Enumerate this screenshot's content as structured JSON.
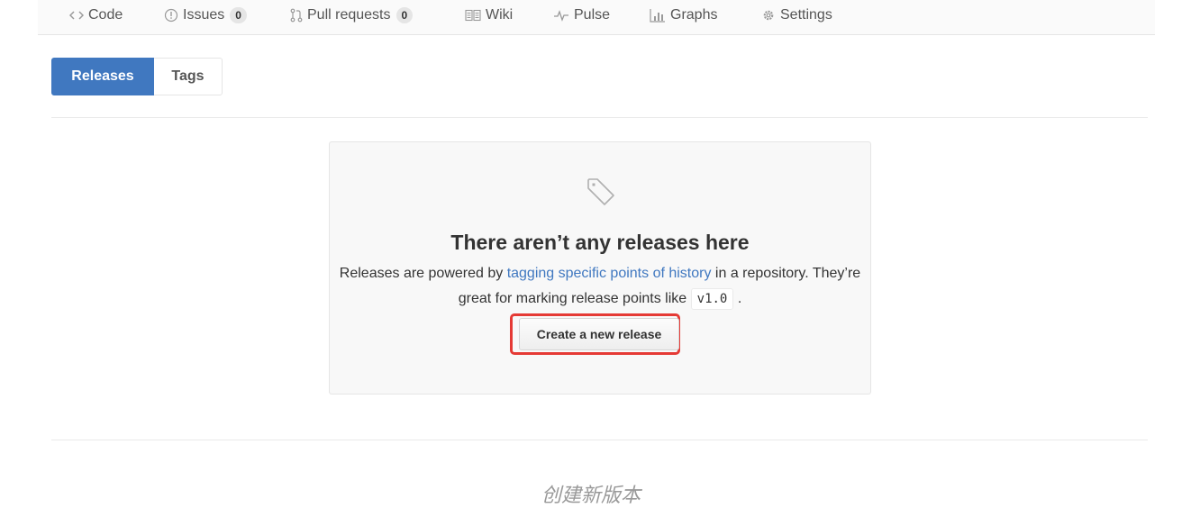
{
  "repo_nav": {
    "code": {
      "label": "Code",
      "icon": "code-icon"
    },
    "issues": {
      "label": "Issues",
      "count": "0",
      "icon": "issue-opened-icon"
    },
    "pull_requests": {
      "label": "Pull requests",
      "count": "0",
      "icon": "git-pull-request-icon"
    },
    "wiki": {
      "label": "Wiki",
      "icon": "book-icon"
    },
    "pulse": {
      "label": "Pulse",
      "icon": "pulse-icon"
    },
    "graphs": {
      "label": "Graphs",
      "icon": "graph-icon"
    },
    "settings": {
      "label": "Settings",
      "icon": "gear-icon"
    }
  },
  "subnav": {
    "releases": "Releases",
    "tags": "Tags"
  },
  "blankslate": {
    "icon": "tag-icon",
    "title": "There aren’t any releases here",
    "text_before_link": "Releases are powered by ",
    "link_text": "tagging specific points of history",
    "text_after_link": " in a repository. They’re great for marking release points like ",
    "code_example": "v1.0",
    "text_end": ".",
    "button_label": "Create a new release"
  },
  "caption": "创建新版本",
  "colors": {
    "accent": "#4078c0",
    "highlight": "#e53a35"
  }
}
